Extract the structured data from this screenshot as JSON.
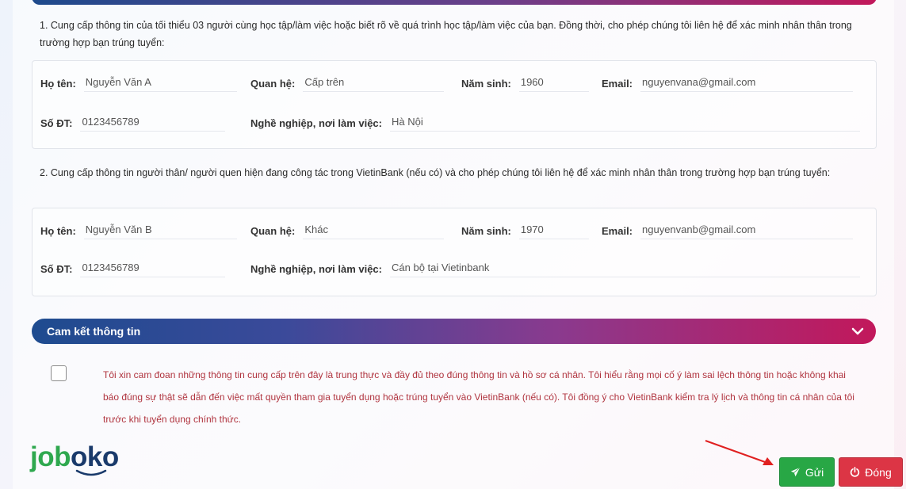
{
  "section1": {
    "intro": "1. Cung cấp thông tin của tối thiểu 03 người cùng học tập/làm việc hoặc biết rõ về quá trình học tập/làm việc của bạn. Đồng thời, cho phép chúng tôi liên hệ để xác minh nhân thân trong trường hợp bạn trúng tuyển:",
    "person": {
      "name_label": "Họ tên:",
      "name": "Nguyễn Văn A",
      "relation_label": "Quan hệ:",
      "relation": "Cấp trên",
      "birth_label": "Năm sinh:",
      "birth": "1960",
      "email_label": "Email:",
      "email": "nguyenvana@gmail.com",
      "phone_label": "Số ĐT:",
      "phone": "0123456789",
      "job_label": "Nghề nghiệp, nơi làm việc:",
      "job": "Hà Nội"
    }
  },
  "section2": {
    "intro": "2. Cung cấp thông tin người thân/ người quen hiện đang công tác trong VietinBank (nếu có) và cho phép chúng tôi liên hệ để xác minh nhân thân trong trường hợp bạn trúng tuyển:",
    "person": {
      "name_label": "Họ tên:",
      "name": "Nguyễn Văn B",
      "relation_label": "Quan hệ:",
      "relation": "Khác",
      "birth_label": "Năm sinh:",
      "birth": "1970",
      "email_label": "Email:",
      "email": "nguyenvanb@gmail.com",
      "phone_label": "Số ĐT:",
      "phone": "0123456789",
      "job_label": "Nghề nghiệp, nơi làm việc:",
      "job": "Cán bộ tại Vietinbank"
    }
  },
  "commitment": {
    "title": "Cam kết thông tin",
    "text": "Tôi xin cam đoan những thông tin cung cấp trên đây là trung thực và đầy đủ theo đúng thông tin và hồ sơ cá nhân. Tôi hiểu rằng mọi cố ý làm sai lệch thông tin hoặc không khai báo đúng sự thật sẽ dẫn đến việc mất quyền tham gia tuyển dụng hoặc trúng tuyển vào VietinBank (nếu có). Tôi đồng ý cho VietinBank kiểm tra lý lịch và thông tin cá nhân của tôi trước khi tuyển dụng chính thức.",
    "checked": false
  },
  "buttons": {
    "send": "Gửi",
    "close": "Đóng"
  },
  "logo": {
    "part1": "job",
    "part2": "oko"
  },
  "colors": {
    "bar_start": "#1e4b8f",
    "bar_end": "#c2185b",
    "send": "#28a745",
    "close": "#dc3545",
    "commit_text": "#b0343f",
    "arrow": "#e02020",
    "logo_green": "#2fa84f",
    "logo_navy": "#1a3a6b"
  },
  "icons": [
    "paper-plane-icon",
    "power-icon",
    "chevron-down-icon",
    "red-arrow-annotation"
  ]
}
